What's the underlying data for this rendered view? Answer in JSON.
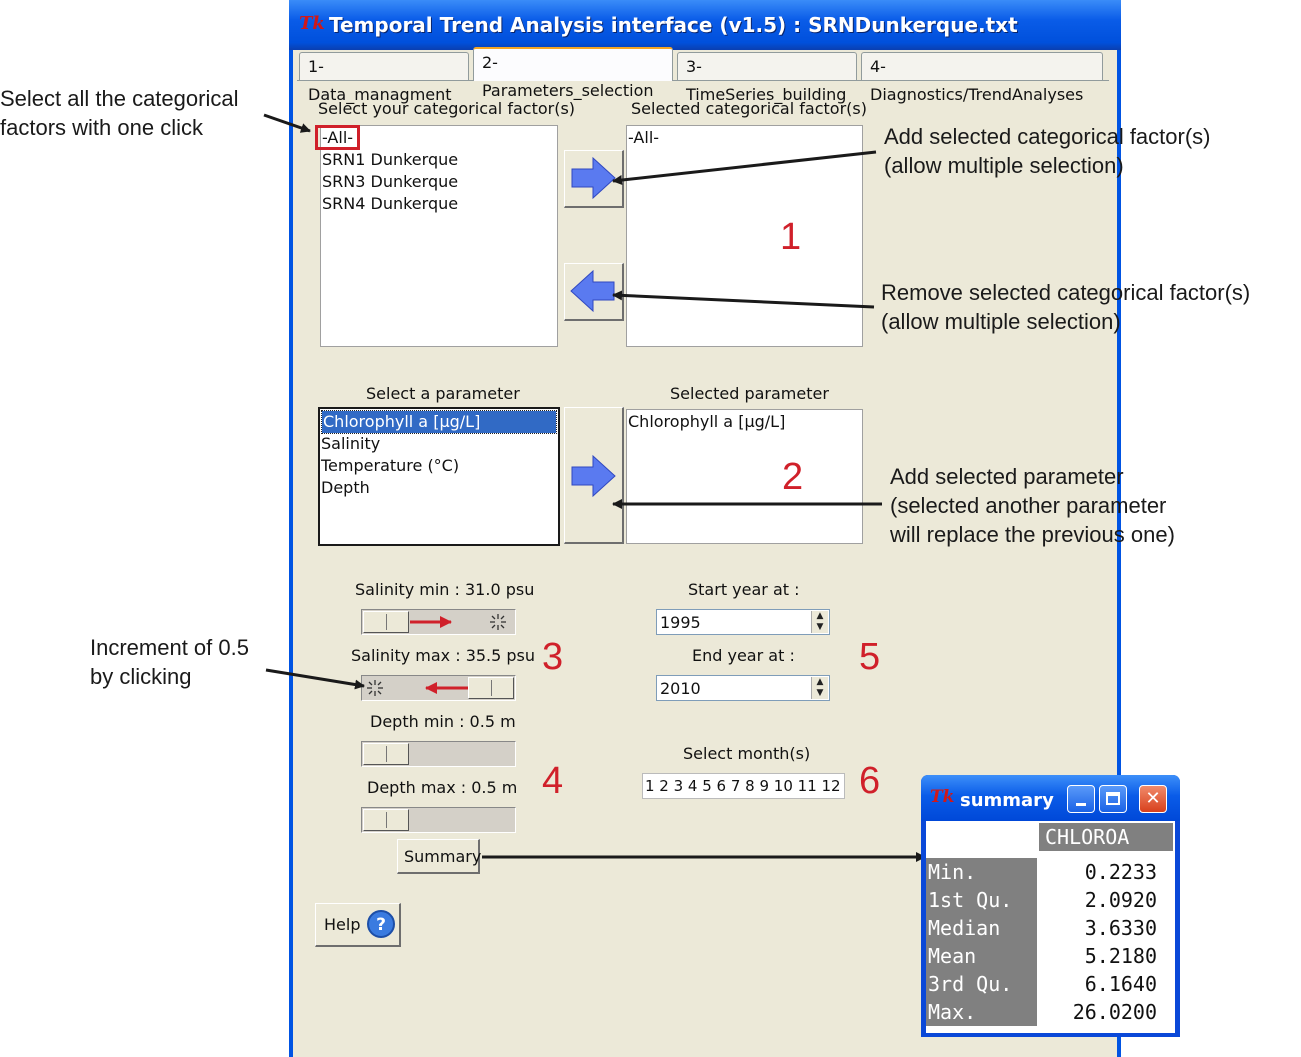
{
  "window": {
    "title": "Temporal Trend Analysis interface (v1.5) : SRNDunkerque.txt",
    "app_icon": "Tk"
  },
  "tabs": [
    {
      "label": "1-Data_managment"
    },
    {
      "label": "2-Parameters_selection",
      "active": true
    },
    {
      "label": "3-TimeSeries_building"
    },
    {
      "label": "4-Diagnostics/TrendAnalyses"
    }
  ],
  "factors": {
    "available_label": "Select your categorical factor(s)",
    "selected_label": "Selected categorical factor(s)",
    "available": [
      "-All-",
      "SRN1 Dunkerque",
      "SRN3 Dunkerque",
      "SRN4 Dunkerque"
    ],
    "selected": [
      "-All-"
    ]
  },
  "parameter": {
    "available_label": "Select a parameter",
    "selected_label": "Selected parameter",
    "available": [
      "Chlorophyll a [µg/L]",
      "Salinity",
      "Temperature (°C)",
      "Depth"
    ],
    "selected": [
      "Chlorophyll a [µg/L]"
    ]
  },
  "sliders": {
    "salinity_min": "Salinity min : 31.0 psu",
    "salinity_max": "Salinity max : 35.5 psu",
    "depth_min": "Depth min : 0.5 m",
    "depth_max": "Depth max : 0.5 m"
  },
  "years": {
    "start_label": "Start year at :",
    "start_value": "1995",
    "end_label": "End year at :",
    "end_value": "2010"
  },
  "months": {
    "label": "Select month(s)",
    "values": "1 2 3 4 5 6 7 8 9 10 11 12"
  },
  "buttons": {
    "summary": "Summary",
    "help": "Help"
  },
  "annotations": {
    "select_all": [
      "Select all the categorical",
      "factors with one click"
    ],
    "add_factor": [
      "Add selected categorical factor(s)",
      "(allow multiple selection)"
    ],
    "remove_factor": [
      "Remove selected categorical factor(s)",
      "(allow multiple selection)"
    ],
    "add_parameter": [
      "Add selected parameter",
      "(selected another parameter",
      "will replace the previous one)"
    ],
    "increment": [
      "Increment of 0.5",
      "by clicking"
    ],
    "numbers": [
      "1",
      "2",
      "3",
      "4",
      "5",
      "6"
    ]
  },
  "summary_window": {
    "title": "summary",
    "column": "CHLOROA",
    "rows": [
      {
        "name": "Min.",
        "value": "0.2233"
      },
      {
        "name": "1st Qu.",
        "value": "2.0920"
      },
      {
        "name": "Median",
        "value": "3.6330"
      },
      {
        "name": "Mean",
        "value": "5.2180"
      },
      {
        "name": "3rd Qu.",
        "value": "6.1640"
      },
      {
        "name": "Max.",
        "value": "26.0200"
      }
    ]
  },
  "colors": {
    "xp_blue": "#0054e3",
    "panel": "#ece9d8",
    "selection": "#316ac5",
    "annotation_red": "#d0202a",
    "arrow_blue": "#5a7af0"
  }
}
